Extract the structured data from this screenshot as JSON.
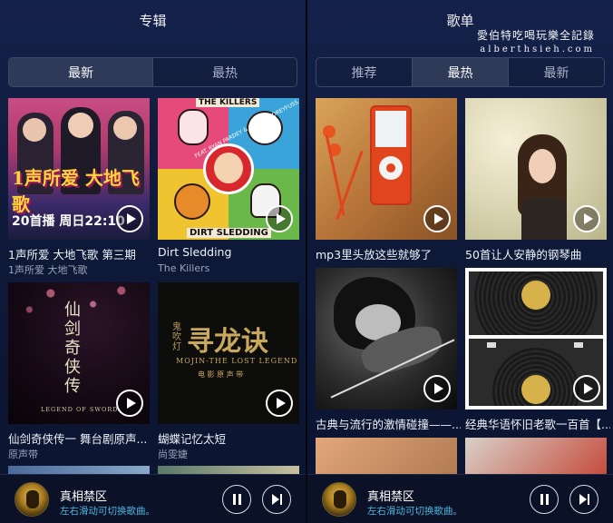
{
  "left": {
    "title": "专辑",
    "tabs": [
      {
        "label": "最新",
        "active": true
      },
      {
        "label": "最热",
        "active": false
      }
    ],
    "items": [
      {
        "title": "1声所爱 大地飞歌 第三期",
        "subtitle": "1声所爱 大地飞歌",
        "cover_text": "1声所爱 大地飞歌",
        "cover_banner": "20首播 周日22:10"
      },
      {
        "title": "Dirt Sledding",
        "subtitle": "The Killers",
        "cover_top": "THE KILLERS",
        "cover_ribbon": "FEAT. RYAN PARDEY & RICHARD DREYFUSS",
        "cover_bottom": "DIRT SLEDDING"
      },
      {
        "title": "仙剑奇侠传一 舞台剧原声...",
        "subtitle": "原声带",
        "cover_text": "仙剑奇侠传",
        "cover_sub": "LEGEND OF SWORD"
      },
      {
        "title": "蝴蝶记忆太短",
        "subtitle": "尚雯婕",
        "cover_text": "寻龙诀",
        "cover_small": "鬼吹灯",
        "cover_sub": "MOJIN-THE LOST LEGEND",
        "cover_sub2": "电 影 原 声 带"
      }
    ]
  },
  "right": {
    "title": "歌单",
    "tabs": [
      {
        "label": "推荐",
        "active": false
      },
      {
        "label": "最热",
        "active": true
      },
      {
        "label": "最新",
        "active": false
      }
    ],
    "items": [
      {
        "title": "mp3里头放这些就够了"
      },
      {
        "title": "50首让人安静的钢琴曲"
      },
      {
        "title": "古典与流行的激情碰撞——..."
      },
      {
        "title": "经典华语怀旧老歌一百首【..."
      }
    ]
  },
  "watermark": {
    "line1": "愛伯特吃喝玩樂全記錄",
    "line2": "alberthsieh.com"
  },
  "player": {
    "song": "真相禁区",
    "hint": "左右滑动可切换歌曲。"
  }
}
